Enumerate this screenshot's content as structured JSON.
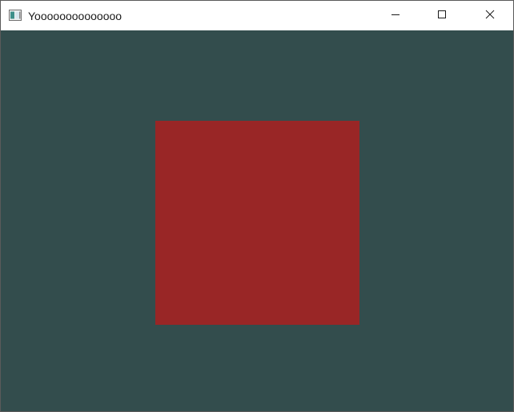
{
  "window": {
    "title": "Yoooooooooooooo",
    "clear_color": "#334d4d",
    "app_icon": "window-app-icon"
  },
  "caption_buttons": [
    {
      "name": "minimize",
      "icon": "minimize-icon"
    },
    {
      "name": "maximize",
      "icon": "maximize-icon"
    },
    {
      "name": "close",
      "icon": "close-icon"
    }
  ],
  "scene": {
    "shape": "square",
    "fill_color": "#992626"
  }
}
